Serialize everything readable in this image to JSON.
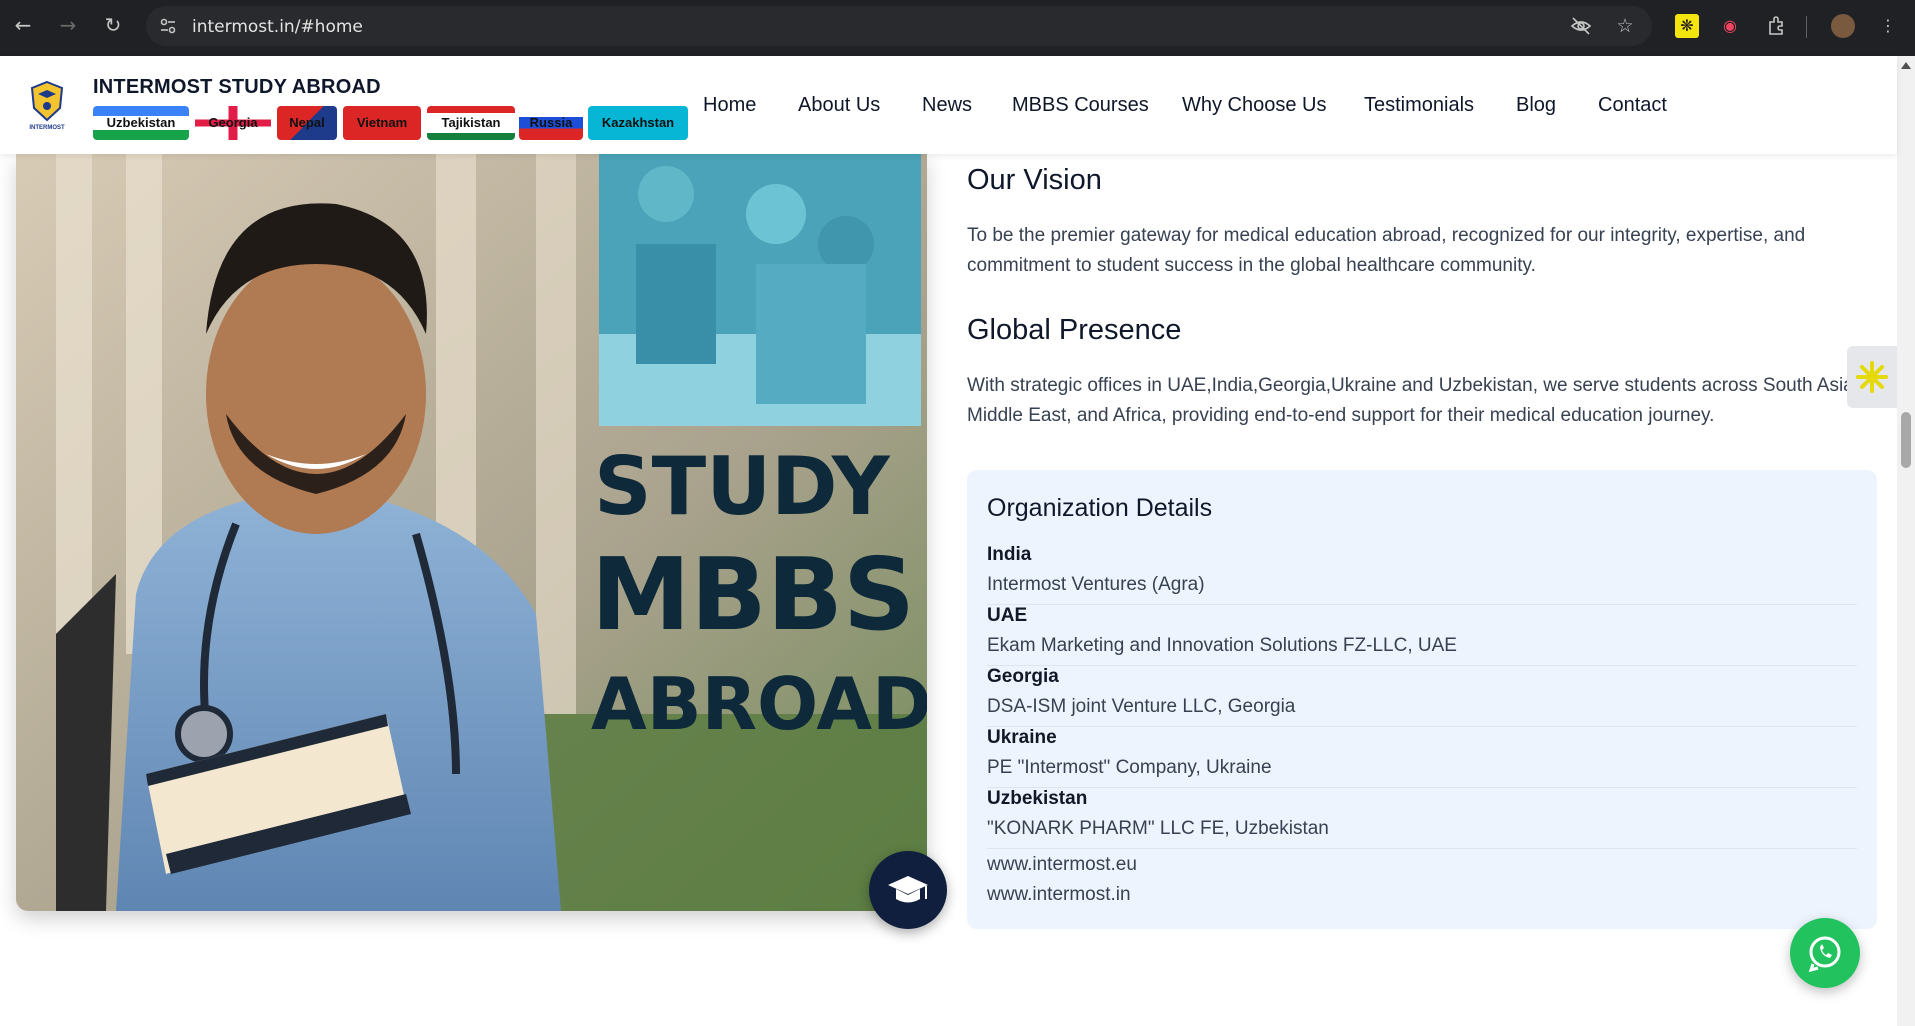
{
  "browser": {
    "url": "intermost.in/#home",
    "back_icon": "arrow-left-icon",
    "forward_icon": "arrow-right-icon",
    "reload_icon": "reload-icon"
  },
  "site": {
    "brand": "INTERMOST STUDY ABROAD",
    "flags": [
      {
        "label": "Uzbekistan"
      },
      {
        "label": "Georgia"
      },
      {
        "label": "Nepal"
      },
      {
        "label": "Vietnam"
      },
      {
        "label": "Tajikistan"
      },
      {
        "label": "Russia"
      },
      {
        "label": "Kazakhstan"
      }
    ],
    "nav": [
      "Home",
      "About Us",
      "News",
      "MBBS Courses",
      "Why Choose Us",
      "Testimonials",
      "Blog",
      "Contact"
    ]
  },
  "hero": {
    "line1": "STUDY",
    "line2": "MBBS",
    "line3": "ABROAD"
  },
  "content": {
    "vision_title": "Our Vision",
    "vision_text": "To be the premier gateway for medical education abroad, recognized for our integrity, expertise, and commitment to student success in the global healthcare community.",
    "presence_title": "Global Presence",
    "presence_text": "With strategic offices in UAE,India,Georgia,Ukraine and Uzbekistan, we serve students across South Asia, Middle East, and Africa, providing end-to-end support for their medical education journey.",
    "org": {
      "title": "Organization Details",
      "rows": [
        {
          "country": "India",
          "company": "Intermost Ventures (Agra)"
        },
        {
          "country": "UAE",
          "company": "Ekam Marketing and Innovation Solutions FZ-LLC, UAE"
        },
        {
          "country": "Georgia",
          "company": "DSA-ISM joint Venture LLC, Georgia"
        },
        {
          "country": "Ukraine",
          "company": "PE \"Intermost\" Company, Ukraine"
        },
        {
          "country": "Uzbekistan",
          "company": "\"KONARK PHARM\" LLC FE, Uzbekistan"
        }
      ],
      "websites": [
        "www.intermost.eu",
        "www.intermost.in"
      ]
    }
  },
  "colors": {
    "navy": "#0f1f3d",
    "whatsapp": "#22c35e",
    "org_bg": "#eef4fd"
  }
}
